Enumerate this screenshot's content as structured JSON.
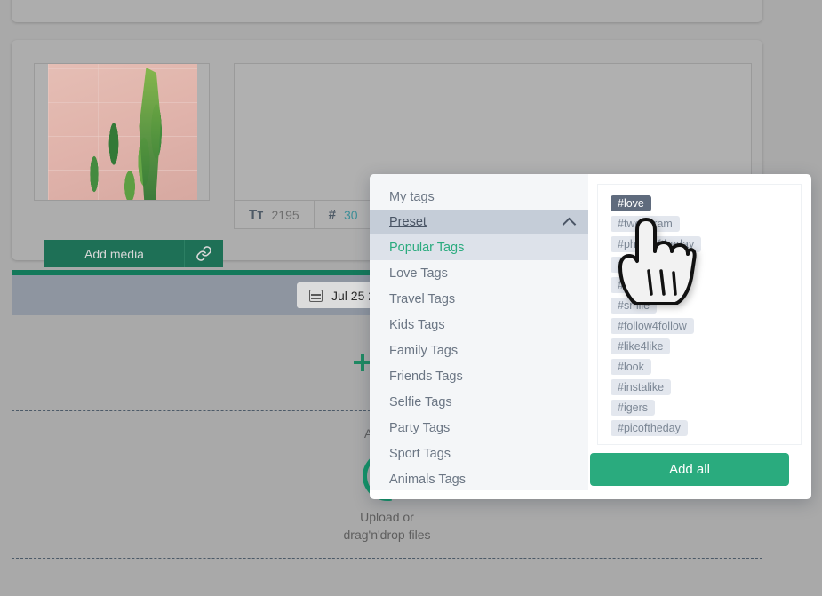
{
  "editor": {
    "thumbnail_alt": "cactus-photo",
    "add_media_label": "Add media",
    "link_icon": "link-icon",
    "counters": [
      {
        "icon": "text-size-icon",
        "glyph": "Tᴛ",
        "value": "2195",
        "accent": false
      },
      {
        "icon": "hashtag-icon",
        "glyph": "#",
        "value": "30",
        "accent": true
      }
    ],
    "image_icon": "image-add-icon",
    "schedule_date": "Jul 25 20",
    "add_comment_label": "Add",
    "dropzone": {
      "title": "Add ima",
      "spinner": "loading-spinner-icon",
      "line1": "Upload or",
      "line2": "drag'n'drop files"
    }
  },
  "tag_modal": {
    "categories": [
      {
        "label": "My tags",
        "type": "item",
        "state": "normal"
      },
      {
        "label": "Preset",
        "type": "header",
        "state": "expanded",
        "chevron": "chevron-up-icon"
      },
      {
        "label": "Popular Tags",
        "type": "item",
        "state": "active"
      },
      {
        "label": "Love Tags",
        "type": "item",
        "state": "normal"
      },
      {
        "label": "Travel Tags",
        "type": "item",
        "state": "normal"
      },
      {
        "label": "Kids Tags",
        "type": "item",
        "state": "normal"
      },
      {
        "label": "Family Tags",
        "type": "item",
        "state": "normal"
      },
      {
        "label": "Friends Tags",
        "type": "item",
        "state": "normal"
      },
      {
        "label": "Selfie Tags",
        "type": "item",
        "state": "normal"
      },
      {
        "label": "Party Tags",
        "type": "item",
        "state": "normal"
      },
      {
        "label": "Sport Tags",
        "type": "item",
        "state": "normal"
      },
      {
        "label": "Animals Tags",
        "type": "item",
        "state": "normal"
      }
    ],
    "tags": [
      {
        "label": "#love",
        "selected": true
      },
      {
        "label": "#tweegram",
        "selected": false
      },
      {
        "label": "#photooftheday",
        "selected": false
      },
      {
        "label": "#20likes",
        "selected": false
      },
      {
        "label": "#amazing",
        "selected": false
      },
      {
        "label": "#smile",
        "selected": false
      },
      {
        "label": "#follow4follow",
        "selected": false
      },
      {
        "label": "#like4like",
        "selected": false
      },
      {
        "label": "#look",
        "selected": false
      },
      {
        "label": "#instalike",
        "selected": false
      },
      {
        "label": "#igers",
        "selected": false
      },
      {
        "label": "#picoftheday",
        "selected": false
      }
    ],
    "add_all_label": "Add all"
  },
  "cursor": {
    "icon": "pointing-hand-cursor"
  },
  "colors": {
    "accent_green": "#2aab7e",
    "dark_green": "#1e7056",
    "progress_green": "#13795b",
    "selected_tag": "#5f6b7d",
    "tag_pill": "#e3e7ee",
    "header_row": "#c5cdd8",
    "active_row": "#dde2ea",
    "teal_count": "#3d8e97"
  }
}
